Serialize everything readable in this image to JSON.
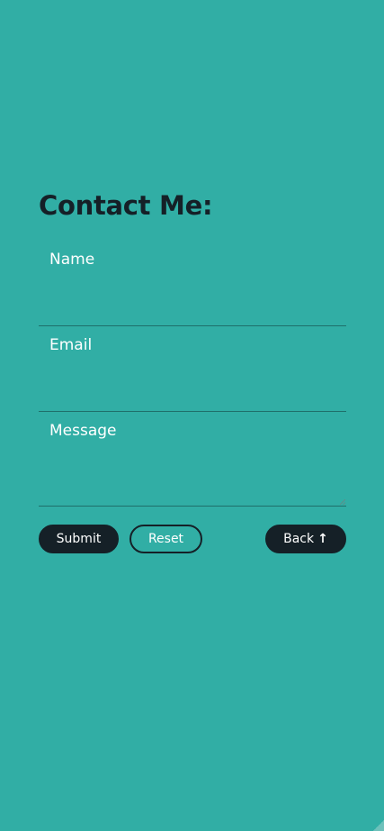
{
  "page": {
    "title": "Contact Me:"
  },
  "form": {
    "name_label": "Name",
    "email_label": "Email",
    "message_label": "Message",
    "name_value": "",
    "email_value": "",
    "message_value": ""
  },
  "buttons": {
    "submit_label": "Submit",
    "reset_label": "Reset",
    "back_label": "Back",
    "back_icon": "arrow-up-icon"
  },
  "colors": {
    "background": "#31aea5",
    "dark": "#152027",
    "text_light": "#ffffff"
  }
}
